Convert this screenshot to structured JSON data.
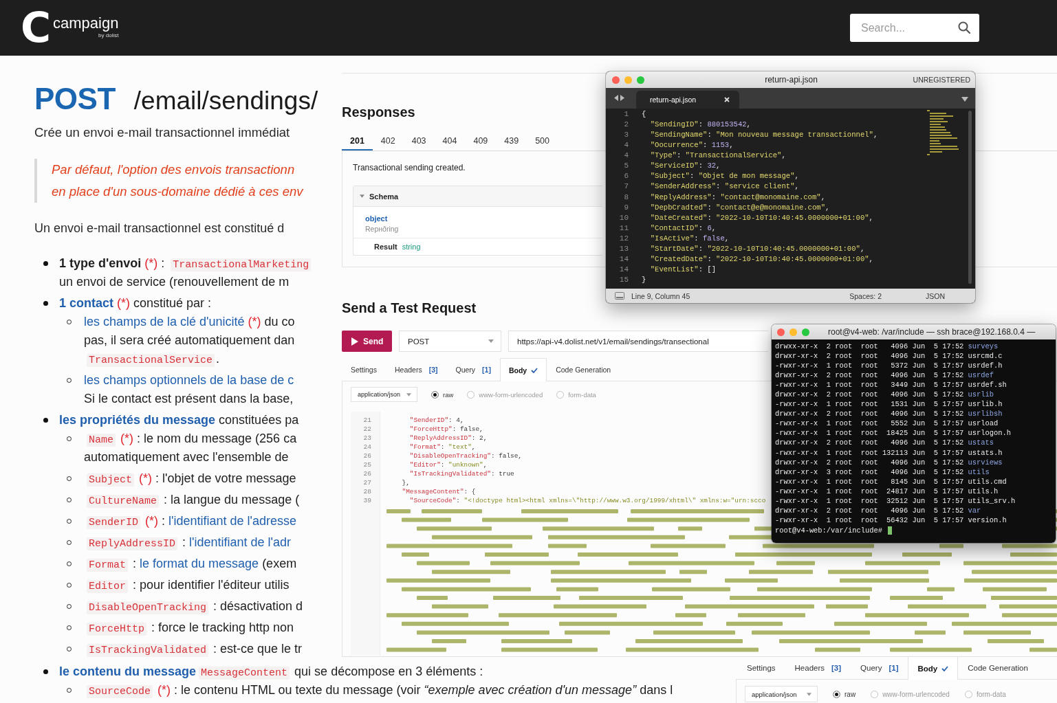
{
  "header": {
    "logo": {
      "mark": "C",
      "name": "campaign",
      "tagline": "by dolist"
    },
    "search": {
      "placeholder": "Search..."
    }
  },
  "doc": {
    "method": "POST",
    "path": "/email/sendings/",
    "summary": "Crée un envoi e-mail transactionnel immédiat",
    "note": [
      "Par défaut, l'option des envois transactionn",
      "en place d'un sous-domaine dédié à ces env"
    ],
    "intro": "Un envoi e-mail transactionnel est constitué d",
    "items": [
      {
        "lines": [
          [
            {
              "kind": "bold",
              "text": "1 type d'envoi"
            },
            {
              "kind": "required",
              "text": " (*)"
            },
            {
              "kind": "text",
              "text": " : "
            },
            {
              "kind": "code",
              "text": "TransactionalMarketing"
            }
          ],
          [
            {
              "kind": "text",
              "text": "un envoi de service (renouvellement de m"
            }
          ]
        ]
      },
      {
        "lines": [
          [
            {
              "kind": "bold-link",
              "text": "1 contact"
            },
            {
              "kind": "required",
              "text": " (*)"
            },
            {
              "kind": "text",
              "text": " constitué par :"
            }
          ]
        ],
        "children": [
          {
            "lines": [
              [
                {
                  "kind": "link",
                  "text": "les champs de la clé d'unicité"
                },
                {
                  "kind": "required",
                  "text": " (*)"
                },
                {
                  "kind": "text",
                  "text": " du co"
                }
              ],
              [
                {
                  "kind": "text",
                  "text": "pas, il sera créé automatiquement dan"
                }
              ],
              [
                {
                  "kind": "code",
                  "text": "TransactionalService"
                },
                {
                  "kind": "text",
                  "text": "."
                }
              ]
            ]
          },
          {
            "lines": [
              [
                {
                  "kind": "link",
                  "text": "les champs optionnels de la base de c"
                }
              ],
              [
                {
                  "kind": "text",
                  "text": "Si le contact est présent dans la base,"
                }
              ]
            ]
          }
        ]
      },
      {
        "lines": [
          [
            {
              "kind": "bold-link",
              "text": "les propriétés du message"
            },
            {
              "kind": "text",
              "text": " constituées pa"
            }
          ]
        ],
        "children": [
          {
            "lines": [
              [
                {
                  "kind": "code",
                  "text": "Name"
                },
                {
                  "kind": "required",
                  "text": " (*)"
                },
                {
                  "kind": "text",
                  "text": " : le nom du message (256 ca"
                }
              ],
              [
                {
                  "kind": "text",
                  "text": "automatiquement avec l'ensemble de"
                }
              ]
            ]
          },
          {
            "lines": [
              [
                {
                  "kind": "code",
                  "text": "Subject"
                },
                {
                  "kind": "required",
                  "text": " (*)"
                },
                {
                  "kind": "text",
                  "text": " : l'objet de votre message"
                }
              ]
            ]
          },
          {
            "lines": [
              [
                {
                  "kind": "code",
                  "text": "CultureName"
                },
                {
                  "kind": "text",
                  "text": " : la langue du message ("
                }
              ]
            ]
          },
          {
            "lines": [
              [
                {
                  "kind": "code",
                  "text": "SenderID"
                },
                {
                  "kind": "required",
                  "text": " (*)"
                },
                {
                  "kind": "text",
                  "text": " : "
                },
                {
                  "kind": "link",
                  "text": "l'identifiant de l'adresse"
                }
              ]
            ]
          },
          {
            "lines": [
              [
                {
                  "kind": "code",
                  "text": "ReplyAddressID"
                },
                {
                  "kind": "text",
                  "text": " : "
                },
                {
                  "kind": "link",
                  "text": "l'identifiant de l'adr"
                }
              ]
            ]
          },
          {
            "lines": [
              [
                {
                  "kind": "code",
                  "text": "Format"
                },
                {
                  "kind": "text",
                  "text": " : "
                },
                {
                  "kind": "link",
                  "text": "le format du message"
                },
                {
                  "kind": "text",
                  "text": " (exem"
                }
              ]
            ]
          },
          {
            "lines": [
              [
                {
                  "kind": "code",
                  "text": "Editor"
                },
                {
                  "kind": "text",
                  "text": " : pour identifier l'éditeur utilis"
                }
              ]
            ]
          },
          {
            "lines": [
              [
                {
                  "kind": "code",
                  "text": "DisableOpenTracking"
                },
                {
                  "kind": "text",
                  "text": " : désactivation d"
                }
              ]
            ]
          },
          {
            "lines": [
              [
                {
                  "kind": "code",
                  "text": "ForceHttp"
                },
                {
                  "kind": "text",
                  "text": " : force le tracking http non"
                }
              ]
            ]
          },
          {
            "lines": [
              [
                {
                  "kind": "code",
                  "text": "IsTrackingValidated"
                },
                {
                  "kind": "text",
                  "text": " : est-ce que le tr"
                }
              ]
            ]
          }
        ]
      }
    ],
    "items_continued": [
      {
        "lines": [
          [
            {
              "kind": "bold-link",
              "text": "le contenu du message"
            },
            {
              "kind": "code",
              "text": "MessageContent"
            },
            {
              "kind": "text",
              "text": " qui se décompose en 3 éléments :"
            }
          ]
        ],
        "children": [
          {
            "lines": [
              [
                {
                  "kind": "code",
                  "text": "SourceCode"
                },
                {
                  "kind": "required",
                  "text": " (*)"
                },
                {
                  "kind": "text",
                  "text": " : le contenu HTML ou texte du message (voir "
                },
                {
                  "kind": "em",
                  "text": "“exemple avec création d'un message”"
                },
                {
                  "kind": "text",
                  "text": " dans l"
                }
              ]
            ]
          }
        ]
      }
    ]
  },
  "responses": {
    "title": "Responses",
    "tabs": [
      {
        "label": "201",
        "selected": true
      },
      {
        "label": "402",
        "selected": false
      },
      {
        "label": "403",
        "selected": false
      },
      {
        "label": "404",
        "selected": false
      },
      {
        "label": "409",
        "selected": false
      },
      {
        "label": "439",
        "selected": false
      },
      {
        "label": "500",
        "selected": false
      }
    ],
    "description": "Transactional sending created.",
    "schema": {
      "title": "Schema",
      "expanded": true,
      "type": "object",
      "subtitle": "Repнðring",
      "fields": [
        {
          "name": "Result",
          "type": "string"
        }
      ]
    }
  },
  "test_request": {
    "title": "Send a Test Request",
    "send_label": "Send",
    "method": "POST",
    "url": "https://api-v4.dolist.net/v1/email/sendings/transectional",
    "tabs": [
      {
        "label": "Settings",
        "selected": false,
        "checked": false
      },
      {
        "label": "Headers",
        "badge": "[3]",
        "selected": false,
        "checked": false
      },
      {
        "label": "Query",
        "badge": "[1]",
        "selected": false,
        "checked": false
      },
      {
        "label": "Body",
        "selected": true,
        "checked": true
      },
      {
        "label": "Code Generation",
        "selected": false,
        "checked": false
      }
    ],
    "content_type": "application/json",
    "body_modes": [
      {
        "label": "raw",
        "selected": true
      },
      {
        "label": "www-form-urlencoded",
        "selected": false
      },
      {
        "label": "form-data",
        "selected": false
      }
    ],
    "code_lines": [
      {
        "number": "21",
        "tokens": [
          {
            "kind": "key",
            "text": "      \"SenderID\""
          },
          {
            "kind": "punct",
            "text": ": "
          },
          {
            "kind": "number",
            "text": "4"
          },
          {
            "kind": "punct",
            "text": ","
          }
        ]
      },
      {
        "number": "22",
        "tokens": [
          {
            "kind": "key",
            "text": "      \"ForceHttp\""
          },
          {
            "kind": "punct",
            "text": ": "
          },
          {
            "kind": "bool",
            "text": "false"
          },
          {
            "kind": "punct",
            "text": ","
          }
        ]
      },
      {
        "number": "23",
        "tokens": [
          {
            "kind": "key",
            "text": "      \"ReplyAddressID\""
          },
          {
            "kind": "punct",
            "text": ": "
          },
          {
            "kind": "number",
            "text": "2"
          },
          {
            "kind": "punct",
            "text": ","
          }
        ]
      },
      {
        "number": "24",
        "tokens": [
          {
            "kind": "key",
            "text": "      \"Format\""
          },
          {
            "kind": "punct",
            "text": ": "
          },
          {
            "kind": "string",
            "text": "\"text\""
          },
          {
            "kind": "punct",
            "text": ","
          }
        ]
      },
      {
        "number": "26",
        "tokens": [
          {
            "kind": "key",
            "text": "      \"DisableOpenTracking\""
          },
          {
            "kind": "punct",
            "text": ": "
          },
          {
            "kind": "bool",
            "text": "false"
          },
          {
            "kind": "punct",
            "text": ","
          }
        ]
      },
      {
        "number": "25",
        "tokens": [
          {
            "kind": "key",
            "text": "      \"Editor\""
          },
          {
            "kind": "punct",
            "text": ": "
          },
          {
            "kind": "string",
            "text": "\"unknown\""
          },
          {
            "kind": "punct",
            "text": ","
          }
        ]
      },
      {
        "number": "26",
        "tokens": [
          {
            "kind": "key",
            "text": "      \"IsTrackingValidated\""
          },
          {
            "kind": "punct",
            "text": ": "
          },
          {
            "kind": "bool",
            "text": "true"
          }
        ]
      },
      {
        "number": "27",
        "tokens": [
          {
            "kind": "punct",
            "text": "    },"
          }
        ]
      },
      {
        "number": "28",
        "tokens": [
          {
            "kind": "key",
            "text": "    \"MessageContent\""
          },
          {
            "kind": "punct",
            "text": ": {"
          }
        ]
      },
      {
        "number": "39",
        "tokens": [
          {
            "kind": "key",
            "text": "      \"SourceCode\""
          },
          {
            "kind": "punct",
            "text": ": "
          },
          {
            "kind": "string",
            "text": "\"<!doctype html><html xmlns=\\\"http://www.w3.org/1999/xhtml\\\" xmlns:w=\"urn:scco"
          }
        ]
      }
    ]
  },
  "editor_window": {
    "title": "return-api.json",
    "license": "UNREGISTERED",
    "tab": {
      "label": "return-api.json"
    },
    "lines": [
      {
        "number": "1",
        "tokens": [
          {
            "kind": "punct",
            "text": "{"
          }
        ]
      },
      {
        "number": "2",
        "tokens": [
          {
            "kind": "key",
            "text": "  \"SendingID\""
          },
          {
            "kind": "punct",
            "text": ": "
          },
          {
            "kind": "number",
            "text": "880153542"
          },
          {
            "kind": "punct",
            "text": ","
          }
        ]
      },
      {
        "number": "3",
        "tokens": [
          {
            "kind": "key",
            "text": "  \"SendingName\""
          },
          {
            "kind": "punct",
            "text": ": "
          },
          {
            "kind": "string",
            "text": "\"Mon nouveau message transactionnel\""
          },
          {
            "kind": "punct",
            "text": ","
          }
        ]
      },
      {
        "number": "4",
        "tokens": [
          {
            "kind": "key",
            "text": "  \"Oocurrence\""
          },
          {
            "kind": "punct",
            "text": ": "
          },
          {
            "kind": "number",
            "text": "1153"
          },
          {
            "kind": "punct",
            "text": ","
          }
        ]
      },
      {
        "number": "4",
        "tokens": [
          {
            "kind": "key",
            "text": "  \"Type\""
          },
          {
            "kind": "punct",
            "text": ": "
          },
          {
            "kind": "string",
            "text": "\"TransactionalService\""
          },
          {
            "kind": "punct",
            "text": ","
          }
        ]
      },
      {
        "number": "5",
        "tokens": [
          {
            "kind": "key",
            "text": "  \"ServiceID\""
          },
          {
            "kind": "punct",
            "text": ": "
          },
          {
            "kind": "number",
            "text": "32"
          },
          {
            "kind": "punct",
            "text": ","
          }
        ]
      },
      {
        "number": "6",
        "tokens": [
          {
            "kind": "key",
            "text": "  \"Subject\""
          },
          {
            "kind": "punct",
            "text": ": "
          },
          {
            "kind": "string",
            "text": "\"Objet de mon message\""
          },
          {
            "kind": "punct",
            "text": ","
          }
        ]
      },
      {
        "number": "7",
        "tokens": [
          {
            "kind": "key",
            "text": "  \"SenderAddress\""
          },
          {
            "kind": "punct",
            "text": ": "
          },
          {
            "kind": "string",
            "text": "\"service client\""
          },
          {
            "kind": "punct",
            "text": ","
          }
        ]
      },
      {
        "number": "8",
        "tokens": [
          {
            "kind": "key",
            "text": "  \"ReplyAddress\""
          },
          {
            "kind": "punct",
            "text": ": "
          },
          {
            "kind": "string",
            "text": "\"contact@monomaine.com\""
          },
          {
            "kind": "punct",
            "text": ","
          }
        ]
      },
      {
        "number": "9",
        "tokens": [
          {
            "kind": "key",
            "text": "  \"DepbCradted\""
          },
          {
            "kind": "punct",
            "text": ": "
          },
          {
            "kind": "string",
            "text": "\"contact@e@monomaine.com\""
          },
          {
            "kind": "punct",
            "text": ","
          }
        ]
      },
      {
        "number": "10",
        "tokens": [
          {
            "kind": "key",
            "text": "  \"DateCreated\""
          },
          {
            "kind": "punct",
            "text": ": "
          },
          {
            "kind": "string",
            "text": "\"2022-10-10T10:40:45.0000000+01:00\""
          },
          {
            "kind": "punct",
            "text": ","
          }
        ]
      },
      {
        "number": "11",
        "tokens": [
          {
            "kind": "key",
            "text": "  \"ContactID\""
          },
          {
            "kind": "punct",
            "text": ": "
          },
          {
            "kind": "number",
            "text": "6"
          },
          {
            "kind": "punct",
            "text": ","
          }
        ]
      },
      {
        "number": "12",
        "tokens": [
          {
            "kind": "key",
            "text": "  \"IsActive\""
          },
          {
            "kind": "punct",
            "text": ": "
          },
          {
            "kind": "bool",
            "text": "false"
          },
          {
            "kind": "punct",
            "text": ","
          }
        ]
      },
      {
        "number": "13",
        "tokens": [
          {
            "kind": "key",
            "text": "  \"StartDate\""
          },
          {
            "kind": "punct",
            "text": ": "
          },
          {
            "kind": "string",
            "text": "\"2022-10-10T10:40:45.0000000+01:00\""
          },
          {
            "kind": "punct",
            "text": ","
          }
        ]
      },
      {
        "number": "14",
        "tokens": [
          {
            "kind": "key",
            "text": "  \"CreatedDate\""
          },
          {
            "kind": "punct",
            "text": ": "
          },
          {
            "kind": "string",
            "text": "\"2022-10-10T10:40:45.0000000+01:00\""
          },
          {
            "kind": "punct",
            "text": ","
          }
        ]
      },
      {
        "number": "14",
        "tokens": [
          {
            "kind": "key",
            "text": "  \"EventList\""
          },
          {
            "kind": "punct",
            "text": ": []"
          }
        ]
      },
      {
        "number": "15",
        "tokens": [
          {
            "kind": "punct",
            "text": "}"
          }
        ]
      }
    ],
    "status": {
      "position": "Line 9, Column 45",
      "indent": "Spaces: 2",
      "syntax": "JSON"
    }
  },
  "terminal_window": {
    "title": "root@v4-web: /var/include — ssh brace@192.168.0.4 —",
    "rows": [
      {
        "listing": "drwxx-xr-x  2 root  root   4096 Jun  5 17:52",
        "name": "surveys",
        "kind": "dir"
      },
      {
        "listing": "drwxr-xr-x  2 root  root   4096 Jun  5 17:52",
        "name": "usrcmd.c",
        "kind": "file"
      },
      {
        "listing": "-rwxr-xr-x  1 root  root   5372 Jun  5 17:57",
        "name": "usrdef.h",
        "kind": "file"
      },
      {
        "listing": "drwxr-xr-x  2 root  root   4096 Jun  5 17:52",
        "name": "usrdef",
        "kind": "dir"
      },
      {
        "listing": "-rwxr-xr-x  1 root  root   3449 Jun  5 17:57",
        "name": "usrdef.sh",
        "kind": "file"
      },
      {
        "listing": "drwxr-xr-x  2 root  root   4096 Jun  5 17:52",
        "name": "usrlib",
        "kind": "dir"
      },
      {
        "listing": "-rwxr-xr-x  1 root  root   1531 Jun  5 17:57",
        "name": "usrlib.h",
        "kind": "file"
      },
      {
        "listing": "drwxr-xr-x  2 root  root   4096 Jun  5 17:52",
        "name": "usrlibsh",
        "kind": "dir"
      },
      {
        "listing": "-rwxr-xr-x  1 root  root   5552 Jun  5 17:57",
        "name": "usrload",
        "kind": "file"
      },
      {
        "listing": "-rwxr-xr-x  1 root  root  18425 Jun  5 17:57",
        "name": "usrlogon.h",
        "kind": "file"
      },
      {
        "listing": "drwxr-xr-x  2 root  root   4096 Jun  5 17:52",
        "name": "ustats",
        "kind": "dir"
      },
      {
        "listing": "-rwxr-xr-x  1 root  root 132113 Jun  5 17:57",
        "name": "ustats.h",
        "kind": "file"
      },
      {
        "listing": "drwxr-xr-x  2 root  root   4096 Jun  5 17:52",
        "name": "usrviews",
        "kind": "dir"
      },
      {
        "listing": "drwxr-xr-x  3 root  root   4096 Jun  5 17:52",
        "name": "utils",
        "kind": "dir"
      },
      {
        "listing": "-rwxr-xr-x  1 root  root   8145 Jun  5 17:57",
        "name": "utils.cmd",
        "kind": "file"
      },
      {
        "listing": "-rwxr-xr-x  1 root  root  24817 Jun  5 17:57",
        "name": "utils.h",
        "kind": "file"
      },
      {
        "listing": "-rwxr-xr-x  1 root  root  32512 Jun  5 17:57",
        "name": "utils_srv.h",
        "kind": "file"
      },
      {
        "listing": "drwxr-xr-x  2 root  root   4096 Jun  5 17:52",
        "name": "var",
        "kind": "dir"
      },
      {
        "listing": "-rwxr-xr-x  1 root  root  56432 Jun  5 17:57",
        "name": "version.h",
        "kind": "file"
      }
    ],
    "prompt": "root@v4-web:/var/include#"
  },
  "bottom_panel": {
    "tabs": [
      {
        "label": "Settings",
        "selected": false,
        "checked": false
      },
      {
        "label": "Headers",
        "badge": "[3]",
        "selected": false,
        "checked": false
      },
      {
        "label": "Query",
        "badge": "[1]",
        "selected": false,
        "checked": false
      },
      {
        "label": "Body",
        "selected": true,
        "checked": true
      },
      {
        "label": "Code Generation",
        "selected": false,
        "checked": false
      }
    ],
    "content_type": "application/json",
    "body_modes": [
      {
        "label": "raw",
        "selected": true
      },
      {
        "label": "www-form-urlencoded",
        "selected": false
      },
      {
        "label": "form-data",
        "selected": false
      }
    ]
  }
}
